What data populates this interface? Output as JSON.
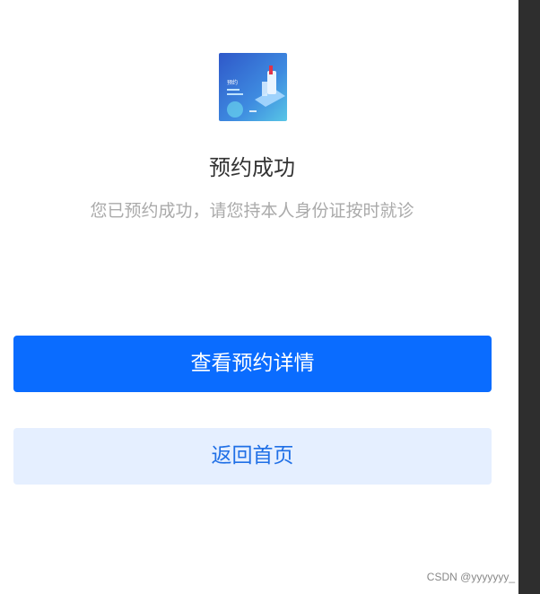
{
  "result": {
    "title": "预约成功",
    "subtitle": "您已预约成功，请您持本人身份证按时就诊"
  },
  "illustration": {
    "icon": "appointment-illustration",
    "caption": "预约"
  },
  "actions": {
    "primary_label": "查看预约详情",
    "secondary_label": "返回首页"
  },
  "watermark": "CSDN @yyyyyyy_",
  "colors": {
    "primary": "#0a6cff",
    "secondary_bg": "#e5efff",
    "secondary_text": "#1f6fe6"
  }
}
